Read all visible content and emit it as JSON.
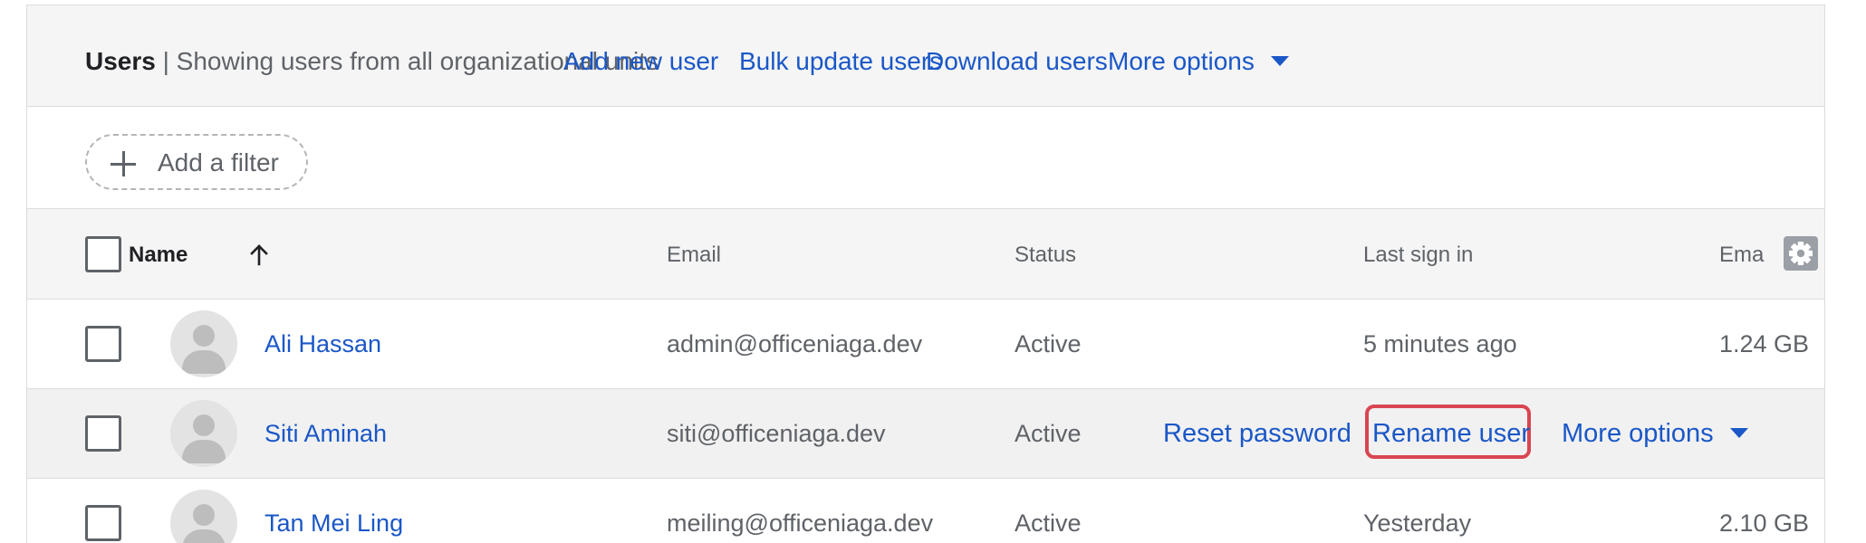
{
  "header": {
    "title": "Users",
    "subtitle": " | Showing users from all organizational units",
    "links": {
      "add_user": "Add new user",
      "bulk_update": "Bulk update users",
      "download": "Download users",
      "more_options": "More options"
    }
  },
  "filter": {
    "add_label": "Add a filter",
    "icon": "plus-icon"
  },
  "table": {
    "columns": {
      "name": "Name",
      "email": "Email",
      "status": "Status",
      "last_sign_in": "Last sign in",
      "email_usage": "Ema"
    },
    "sort": {
      "column": "Name",
      "direction": "ascending"
    },
    "rows": [
      {
        "name": "Ali Hassan",
        "email": "admin@officeniaga.dev",
        "status": "Active",
        "last_sign_in": "5 minutes ago",
        "storage": "1.24 GB"
      },
      {
        "name": "Siti Aminah",
        "email": "siti@officeniaga.dev",
        "status": "Active",
        "last_sign_in": "",
        "storage": ""
      },
      {
        "name": "Tan Mei Ling",
        "email": "meiling@officeniaga.dev",
        "status": "Active",
        "last_sign_in": "Yesterday",
        "storage": "2.10 GB"
      }
    ],
    "hover_actions": {
      "reset_password": "Reset password",
      "rename_user": "Rename user",
      "more_options": "More options"
    }
  },
  "colors": {
    "link": "#1a57c7",
    "highlight": "#d94551",
    "header_bg": "#f5f5f5"
  }
}
